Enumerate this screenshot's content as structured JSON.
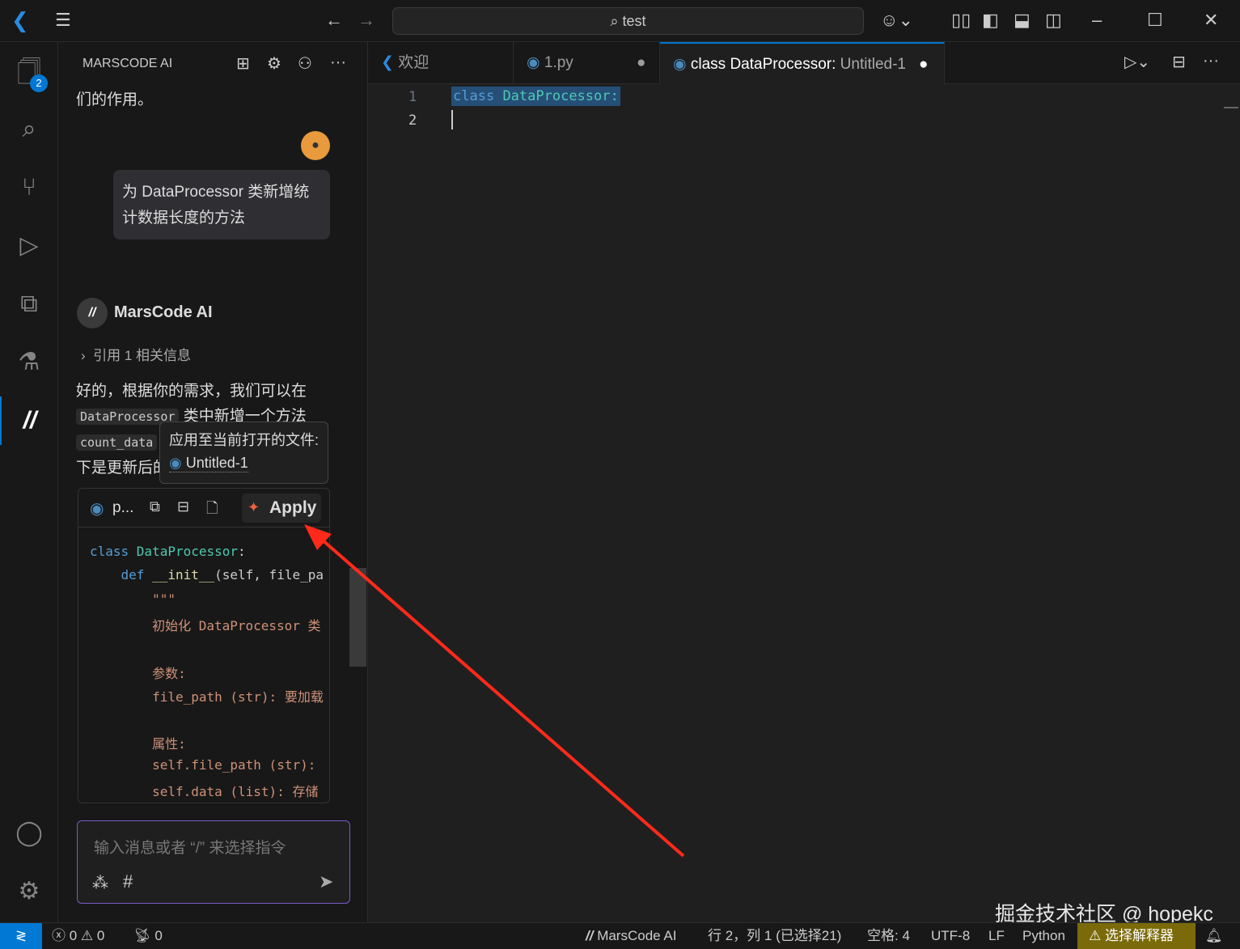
{
  "titlebar": {
    "search_text": "test"
  },
  "side": {
    "title": "MARSCODE AI",
    "badge": "2",
    "prev_text": "们的作用。",
    "user_message": "为 DataProcessor 类新增统计数据长度的方法",
    "ai_name": "MarsCode AI",
    "reference": "引用 1 相关信息",
    "reply_line1": "好的，根据你的需求，我们可以在",
    "reply_code1": "DataProcessor",
    "reply_line2": "类中新增一个方法",
    "reply_code2": "count_data",
    "reply_line3": "下是更新后的",
    "code_lang": "p...",
    "apply_label": "Apply",
    "tooltip_title": "应用至当前打开的文件:",
    "tooltip_file": "Untitled-1",
    "code_lines": [
      {
        "parts": [
          [
            "kw",
            "class "
          ],
          [
            "cls",
            "DataProcessor"
          ],
          [
            "tx",
            ":"
          ]
        ]
      },
      {
        "parts": [
          [
            "tx",
            "    "
          ],
          [
            "kw",
            "def "
          ],
          [
            "fn",
            "__init__"
          ],
          [
            "tx",
            "(self, file_pa"
          ]
        ]
      },
      {
        "parts": [
          [
            "str",
            "        \"\"\""
          ]
        ]
      },
      {
        "parts": [
          [
            "str",
            "        初始化 DataProcessor 类"
          ]
        ]
      },
      {
        "parts": [
          [
            "str",
            ""
          ]
        ]
      },
      {
        "parts": [
          [
            "str",
            "        参数:"
          ]
        ]
      },
      {
        "parts": [
          [
            "str",
            "        file_path (str): 要加载"
          ]
        ]
      },
      {
        "parts": [
          [
            "str",
            ""
          ]
        ]
      },
      {
        "parts": [
          [
            "str",
            "        属性:"
          ]
        ]
      },
      {
        "parts": [
          [
            "str",
            "        self.file_path (str):"
          ]
        ]
      },
      {
        "parts": [
          [
            "str",
            "        self.data (list): 存储"
          ]
        ]
      }
    ],
    "input_placeholder": "输入消息或者 “/” 来选择指令",
    "hash": "#"
  },
  "tabs": [
    {
      "label": "欢迎"
    },
    {
      "label": "1.py"
    },
    {
      "label": "class DataProcessor:",
      "desc": "Untitled-1"
    }
  ],
  "editor": {
    "line_numbers": [
      "1",
      "2"
    ],
    "line1_kw": "class",
    "line1_rest": "DataProcessor:"
  },
  "status": {
    "errors": "0",
    "warnings": "0",
    "ports": "0",
    "marscode": "MarsCode AI",
    "position": "行 2，列 1 (已选择21)",
    "spaces": "空格: 4",
    "encoding": "UTF-8",
    "eol": "LF",
    "language": "Python",
    "interpreter": "选择解释器"
  },
  "watermark": "掘金技术社区 @ hopekc",
  "colors": {
    "accent": "#0078d4",
    "interpreter_bg": "#7a6a0a",
    "arrow": "#ff2a1a"
  }
}
